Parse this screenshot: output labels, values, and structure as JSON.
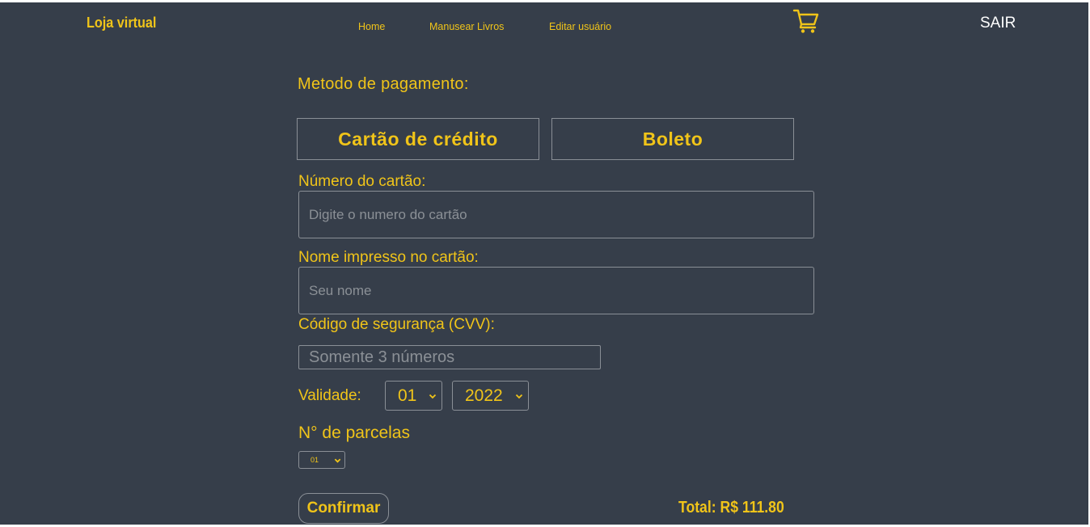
{
  "header": {
    "brand": "Loja virtual",
    "nav": [
      "Home",
      "Manusear Livros",
      "Editar usuário"
    ],
    "cart_icon": "cart-icon",
    "logout_label": "SAIR"
  },
  "payment": {
    "title": "Metodo de pagamento:",
    "methods": [
      "Cartão de crédito",
      "Boleto"
    ],
    "card_number_label": "Número do cartão:",
    "card_number_placeholder": "Digite o numero do cartão",
    "name_label": "Nome impresso no cartão:",
    "name_placeholder": "Seu nome",
    "cvv_label": "Código de segurança (CVV):",
    "cvv_placeholder": "Somente 3 números",
    "validity_label": "Validade:",
    "validity_month": "01",
    "validity_year": "2022",
    "installments_label": "N° de parcelas",
    "installments_value": "01",
    "confirm_label": "Confirmar",
    "total": "Total: R$ 111.80"
  },
  "colors": {
    "background": "#363e4a",
    "accent": "#f0c419",
    "border": "#8a8f96"
  }
}
